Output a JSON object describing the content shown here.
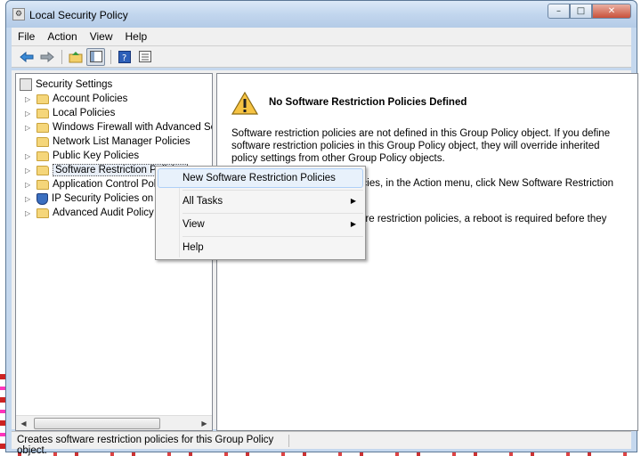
{
  "window": {
    "title": "Local Security Policy"
  },
  "menubar": [
    "File",
    "Action",
    "View",
    "Help"
  ],
  "toolbar": [
    {
      "name": "back-icon",
      "glyph": "⬅"
    },
    {
      "name": "forward-icon",
      "glyph": "➡"
    },
    {
      "name": "up-folder-icon",
      "glyph": "📁"
    },
    {
      "name": "show-hide-tree-icon",
      "glyph": "▤"
    },
    {
      "name": "help-icon",
      "glyph": "?"
    },
    {
      "name": "properties-icon",
      "glyph": "▦"
    }
  ],
  "tree": {
    "root": "Security Settings",
    "items": [
      {
        "label": "Account Policies",
        "expandable": true,
        "icon": "folder"
      },
      {
        "label": "Local Policies",
        "expandable": true,
        "icon": "folder"
      },
      {
        "label": "Windows Firewall with Advanced Secu",
        "expandable": true,
        "icon": "folder"
      },
      {
        "label": "Network List Manager Policies",
        "expandable": false,
        "icon": "folder"
      },
      {
        "label": "Public Key Policies",
        "expandable": true,
        "icon": "folder"
      },
      {
        "label": "Software Restriction Policies",
        "expandable": true,
        "icon": "folder",
        "selected": true
      },
      {
        "label": "Application Control Polic",
        "expandable": true,
        "icon": "folder"
      },
      {
        "label": "IP Security Policies on Lo",
        "expandable": true,
        "icon": "shield"
      },
      {
        "label": "Advanced Audit Policy C",
        "expandable": true,
        "icon": "folder"
      }
    ]
  },
  "detail": {
    "heading": "No Software Restriction Policies Defined",
    "para1": "Software restriction policies are not defined in this Group Policy object. If you define software restriction policies in this Group Policy object, they will override inherited policy settings from other Group Policy objects.",
    "para2_visible": "icies, in the Action menu, click New Software Restriction",
    "para3_visible": "are restriction policies, a reboot is required before they"
  },
  "context_menu": {
    "items": [
      {
        "label": "New Software Restriction Policies",
        "submenu": false
      },
      {
        "label": "All Tasks",
        "submenu": true
      },
      {
        "label": "View",
        "submenu": true
      },
      {
        "label": "Help",
        "submenu": false
      }
    ]
  },
  "status": "Creates software restriction policies for this Group Policy object."
}
